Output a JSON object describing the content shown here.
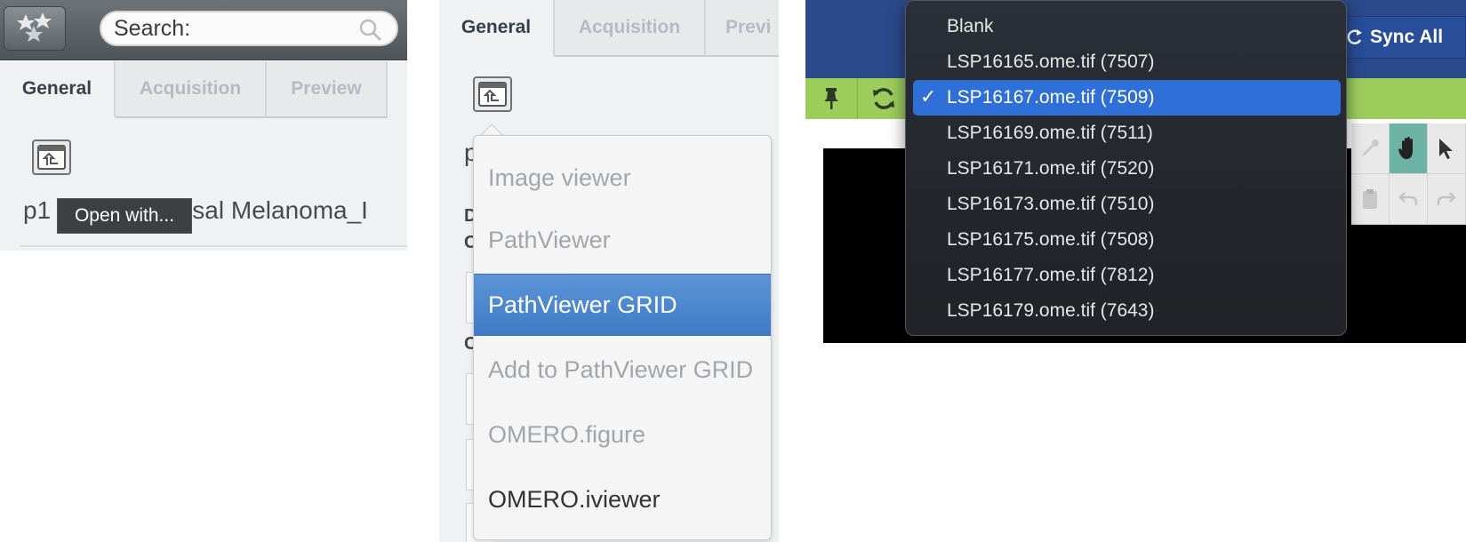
{
  "panel1": {
    "search": {
      "placeholder": "Search:"
    },
    "tabs": [
      {
        "label": "General",
        "active": true
      },
      {
        "label": "Acquisition",
        "active": false
      },
      {
        "label": "Preview",
        "active": false
      }
    ],
    "open_with_icon": "open-with-icon",
    "filename_visible_start": "p1",
    "filename_visible_end": "ousal Melanoma_I",
    "tooltip": "Open with..."
  },
  "panel2": {
    "tabs": [
      {
        "label": "General",
        "active": true
      },
      {
        "label": "Acquisition",
        "active": false
      },
      {
        "label": "Previ",
        "active": false
      }
    ],
    "background_letters": [
      "p",
      "D",
      "C",
      "C"
    ],
    "menu": {
      "items": [
        {
          "label": "Image viewer",
          "state": "disabled"
        },
        {
          "label": "PathViewer",
          "state": "disabled"
        },
        {
          "label": "PathViewer GRID",
          "state": "selected"
        },
        {
          "label": "Add to PathViewer GRID",
          "state": "disabled"
        },
        {
          "label": "OMERO.figure",
          "state": "disabled"
        },
        {
          "label": "OMERO.iviewer",
          "state": "enabled"
        }
      ]
    },
    "selection_color": "#4a87cf"
  },
  "panel3": {
    "sync_all_label": "Sync All",
    "toolbar_icons": [
      "pin-icon",
      "refresh-icon"
    ],
    "tool_icons": [
      "eyedropper-icon",
      "hand-icon",
      "pointer-icon",
      "clipboard-icon",
      "undo-icon",
      "redo-icon"
    ],
    "dropdown": {
      "items": [
        {
          "label": "Blank",
          "selected": false
        },
        {
          "label": "LSP16165.ome.tif (7507)",
          "selected": false
        },
        {
          "label": "LSP16167.ome.tif (7509)",
          "selected": true
        },
        {
          "label": "LSP16169.ome.tif (7511)",
          "selected": false
        },
        {
          "label": "LSP16171.ome.tif (7520)",
          "selected": false
        },
        {
          "label": "LSP16173.ome.tif (7510)",
          "selected": false
        },
        {
          "label": "LSP16175.ome.tif (7508)",
          "selected": false
        },
        {
          "label": "LSP16177.ome.tif (7812)",
          "selected": false
        },
        {
          "label": "LSP16179.ome.tif (7643)",
          "selected": false
        }
      ],
      "check_glyph": "✓"
    },
    "colors": {
      "navbar": "#2b4a8c",
      "toolbar": "#9ccc5c",
      "highlight": "#2f6fd8"
    }
  }
}
